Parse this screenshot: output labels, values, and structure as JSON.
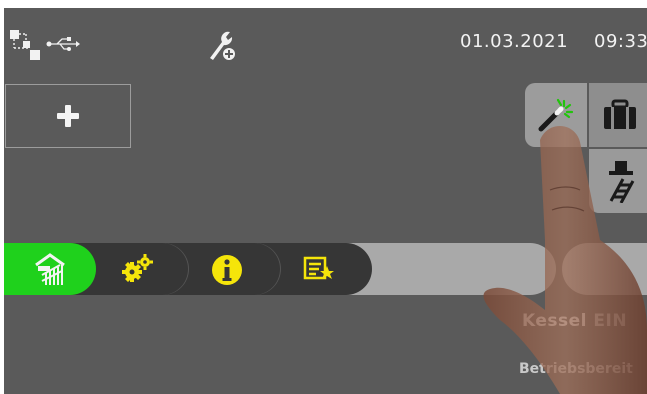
{
  "status_bar": {
    "date": "01.03.2021",
    "time": "09:33",
    "icons": [
      "network-icon",
      "usb-icon",
      "service-wrench-icon"
    ]
  },
  "left_panel": {
    "add_icon": "plus-icon"
  },
  "quick_tiles": [
    {
      "icon": "magic-wand-icon",
      "accent": "#22c40c"
    },
    {
      "icon": "briefcase-icon"
    },
    {
      "icon": "chimney-sweep-icon"
    }
  ],
  "menu_bar": {
    "items": [
      {
        "icon": "home-heating-icon",
        "active": true,
        "color": "#1fd11c"
      },
      {
        "icon": "gears-icon",
        "color": "#f5e50a"
      },
      {
        "icon": "info-icon",
        "color": "#f5e50a"
      },
      {
        "icon": "favorites-list-icon",
        "color": "#f5e50a"
      }
    ]
  },
  "status": {
    "label": "Kessel",
    "state": "EIN",
    "mode": "Betriebsbereit"
  }
}
